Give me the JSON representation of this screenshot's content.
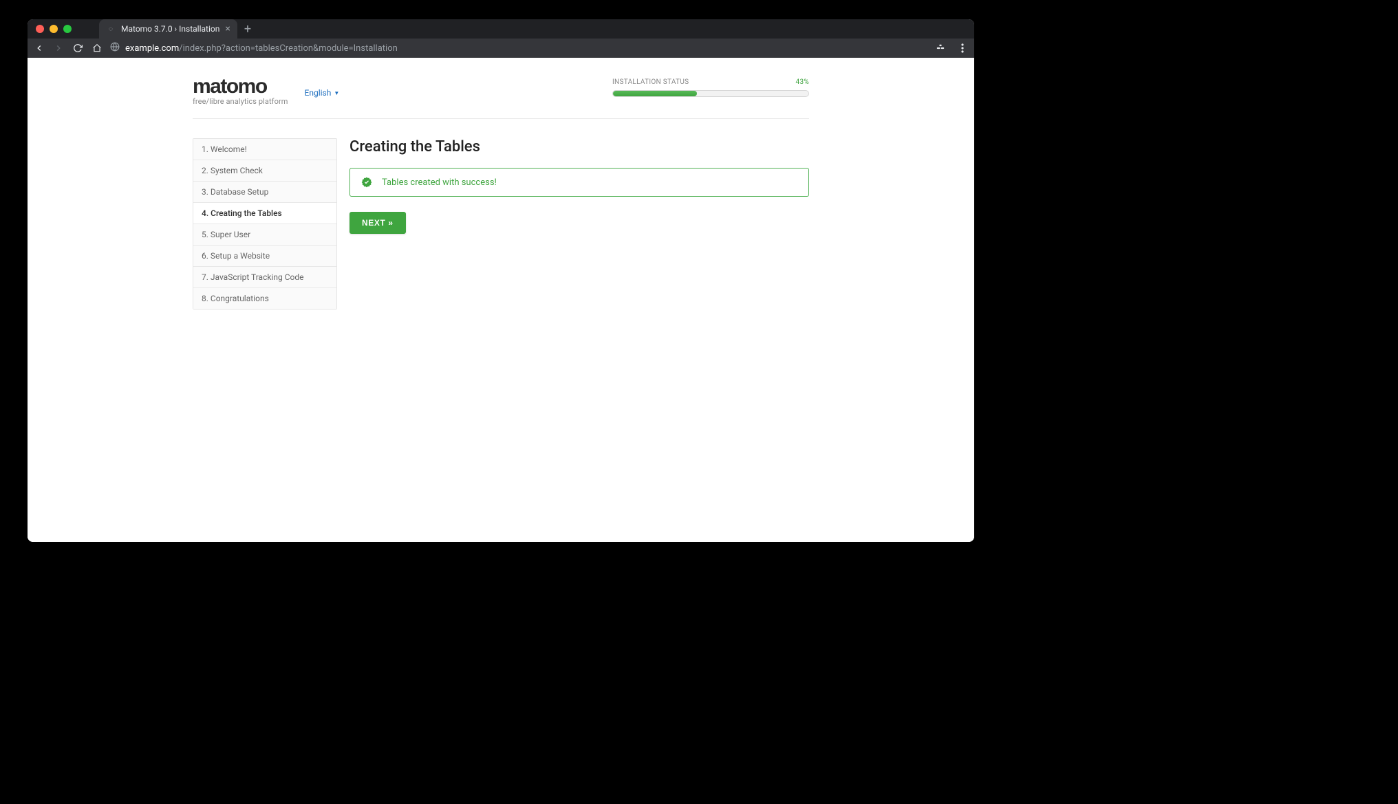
{
  "browser": {
    "tab_title": "Matomo 3.7.0 › Installation",
    "url_host": "example.com",
    "url_path": "/index.php?action=tablesCreation&module=Installation"
  },
  "brand": {
    "name": "matomo",
    "tagline": "free/libre analytics platform"
  },
  "language": {
    "selected": "English"
  },
  "status": {
    "label": "INSTALLATION STATUS",
    "percent_text": "43%",
    "percent_value": 43
  },
  "steps": [
    {
      "label": "1. Welcome!",
      "active": false
    },
    {
      "label": "2. System Check",
      "active": false
    },
    {
      "label": "3. Database Setup",
      "active": false
    },
    {
      "label": "4. Creating the Tables",
      "active": true
    },
    {
      "label": "5. Super User",
      "active": false
    },
    {
      "label": "6. Setup a Website",
      "active": false
    },
    {
      "label": "7. JavaScript Tracking Code",
      "active": false
    },
    {
      "label": "8. Congratulations",
      "active": false
    }
  ],
  "main": {
    "heading": "Creating the Tables",
    "success_message": "Tables created with success!",
    "next_label": "NEXT"
  }
}
